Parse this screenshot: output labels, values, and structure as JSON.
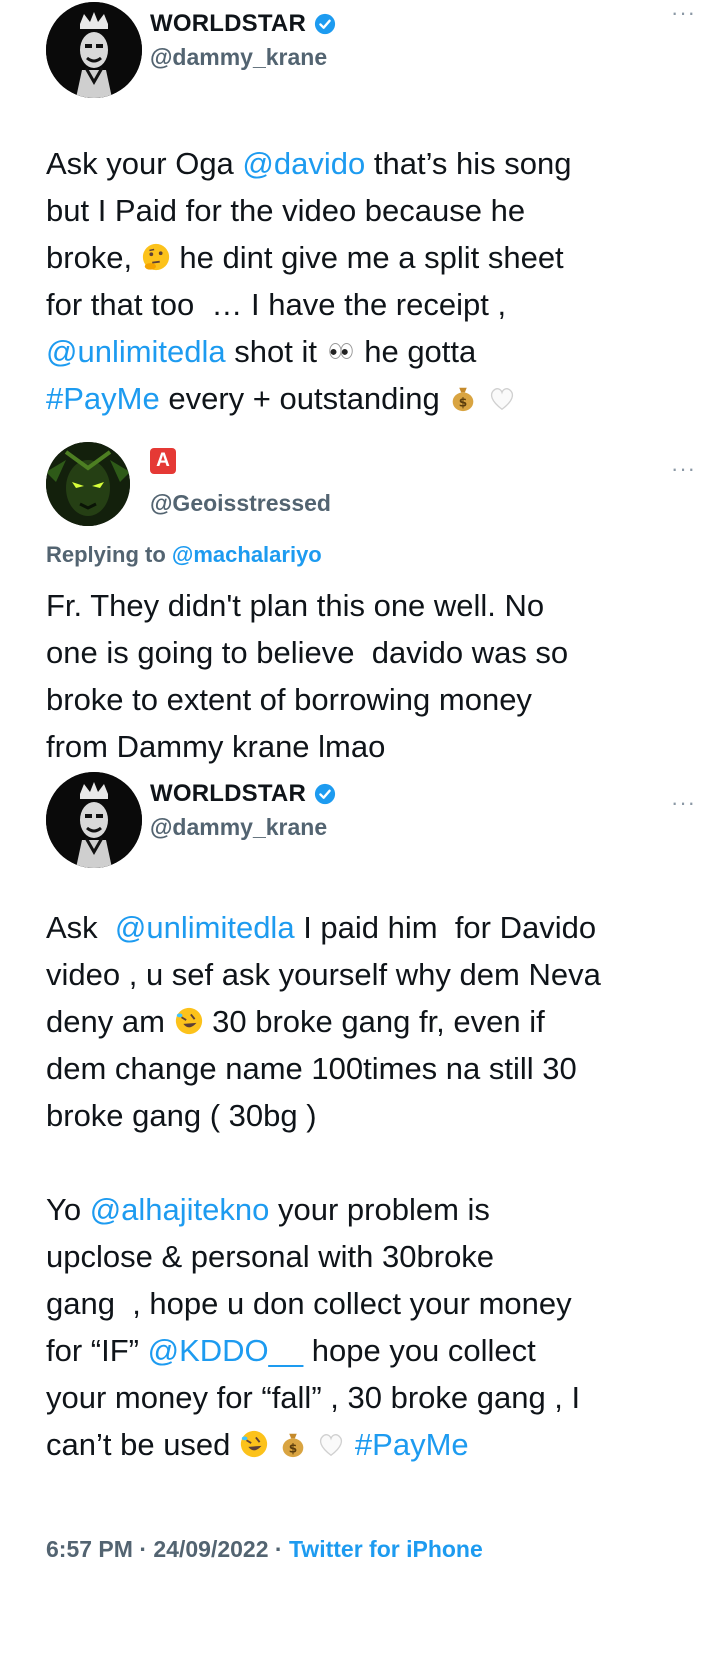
{
  "tweet1": {
    "name": "WORLDSTAR",
    "handle": "@dammy_krane",
    "more": "···",
    "text": {
      "p1": "Ask your Oga ",
      "m1": "@davido",
      "p2": " that’s his song\nbut I Paid for the video because he\nbroke, ",
      "p3": " he dint give me a split sheet\nfor that too  … I have the receipt ,\n",
      "m2": "@unlimitedla",
      "p4": " shot it ",
      "p5": " he gotta\n",
      "h1": "#PayMe",
      "p6": " every + outstanding "
    }
  },
  "reply": {
    "badge": "A",
    "handle": "@Geoisstressed",
    "more": "···",
    "replying_label": "Replying to ",
    "replying_handle": "@machalariyo",
    "text": "Fr. They didn't plan this one well. No\none is going to believe  davido was so\nbroke to extent of borrowing money\nfrom Dammy krane lmao"
  },
  "tweet2": {
    "name": "WORLDSTAR",
    "handle": "@dammy_krane",
    "more": "···",
    "text": {
      "a1": "Ask  ",
      "am1": "@unlimitedla",
      "a2": " I paid him  for Davido\nvideo , u sef ask yourself why dem Neva\ndeny am ",
      "a3": " 30 broke gang fr, even if\ndem change name 100times na still 30\nbroke gang ( 30bg )\n\nYo ",
      "am2": "@alhajitekno",
      "a4": " your problem is\nupclose & personal with 30broke\ngang  , hope u don collect your money\nfor “IF” ",
      "am3": "@KDDO__",
      "a5": " hope you collect\nyour money for “fall” , 30 broke gang , I\ncan’t be used ",
      "ah1": "#PayMe"
    }
  },
  "footer": {
    "time": "6:57 PM",
    "sep1": " · ",
    "date": "24/09/2022",
    "sep2": " · ",
    "source": "Twitter for iPhone"
  },
  "colors": {
    "link": "#1d9bf0",
    "muted": "#536471",
    "verified": "#1d9bf0"
  }
}
